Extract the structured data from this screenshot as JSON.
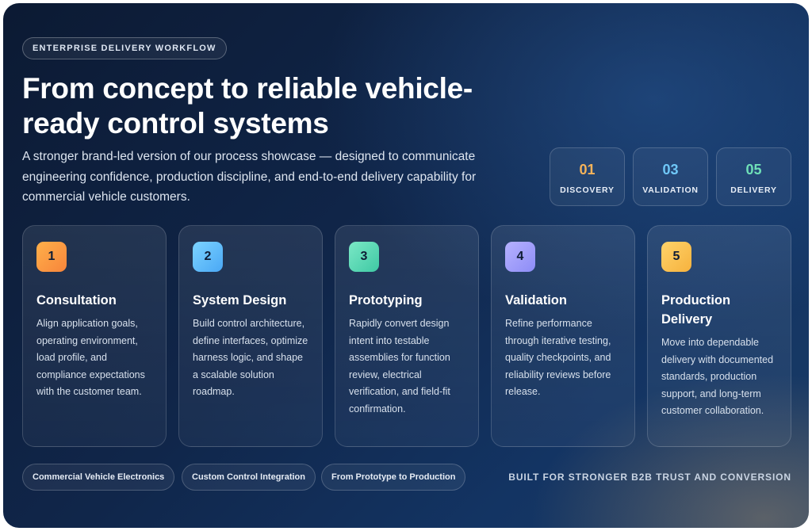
{
  "badge": "ENTERPRISE DELIVERY WORKFLOW",
  "title": "From concept to reliable vehicle-ready control systems",
  "intro": "A stronger brand-led version of our process showcase — designed to communicate engineering confidence, production discipline, and end-to-end delivery capability for commercial vehicle customers.",
  "stats": [
    {
      "number": "01",
      "label": "DISCOVERY",
      "color": "#f4b35a"
    },
    {
      "number": "03",
      "label": "VALIDATION",
      "color": "#6fc7f7"
    },
    {
      "number": "05",
      "label": "DELIVERY",
      "color": "#6fe0b7"
    }
  ],
  "steps": [
    {
      "number": "1",
      "title": "Consultation",
      "description": "Align application goals, operating environment, load profile, and compliance expectations with the customer team.",
      "accent_from": "#ffb04a",
      "accent_to": "#f7853b"
    },
    {
      "number": "2",
      "title": "System Design",
      "description": "Build control architecture, define interfaces, optimize harness logic, and shape a scalable solution roadmap.",
      "accent_from": "#7cd3ff",
      "accent_to": "#4aa8f5"
    },
    {
      "number": "3",
      "title": "Prototyping",
      "description": "Rapidly convert design intent into testable assemblies for function review, electrical verification, and field-fit confirmation.",
      "accent_from": "#7be8c6",
      "accent_to": "#3fc9a4"
    },
    {
      "number": "4",
      "title": "Validation",
      "description": "Refine performance through iterative testing, quality checkpoints, and reliability reviews before release.",
      "accent_from": "#b6b2ff",
      "accent_to": "#8d8cf6"
    },
    {
      "number": "5",
      "title": "Production Delivery",
      "description": "Move into dependable delivery with documented standards, production support, and long-term customer collaboration.",
      "accent_from": "#ffd36a",
      "accent_to": "#f6b23e"
    }
  ],
  "tags": [
    "Commercial Vehicle Electronics",
    "Custom Control Integration",
    "From Prototype to Production"
  ],
  "footer_note": "BUILT FOR STRONGER B2B TRUST AND CONVERSION"
}
